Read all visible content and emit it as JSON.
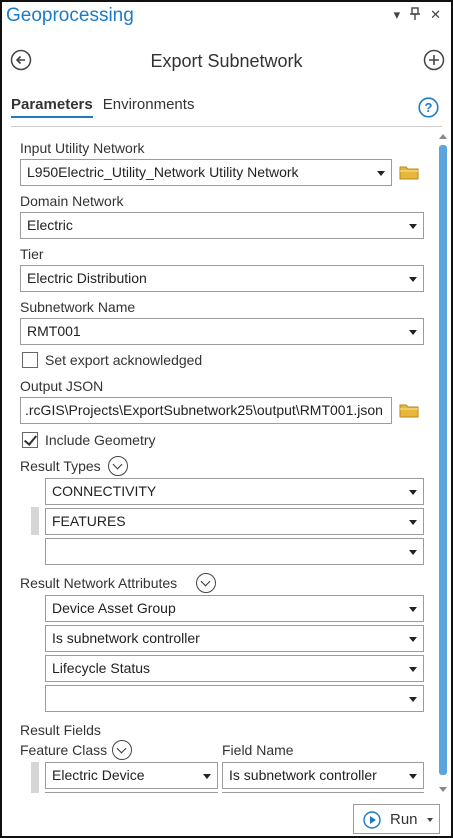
{
  "pane": {
    "title": "Geoprocessing",
    "ctrl_dropdown": "▾",
    "ctrl_pin": "ᚁ",
    "ctrl_close": "✕"
  },
  "tool": {
    "title": "Export Subnetwork"
  },
  "tabs": [
    {
      "label": "Parameters",
      "active": true
    },
    {
      "label": "Environments",
      "active": false
    }
  ],
  "params": {
    "input_network": {
      "label": "Input Utility Network",
      "value": "L950Electric_Utility_Network Utility Network"
    },
    "domain_network": {
      "label": "Domain Network",
      "value": "Electric"
    },
    "tier": {
      "label": "Tier",
      "value": "Electric Distribution"
    },
    "subnetwork_name": {
      "label": "Subnetwork Name",
      "value": "RMT001"
    },
    "set_export_ack": {
      "label": "Set export acknowledged",
      "checked": false
    },
    "output_json": {
      "label": "Output JSON",
      "value": ".rcGIS\\Projects\\ExportSubnetwork25\\output\\RMT001.json"
    },
    "include_geometry": {
      "label": "Include Geometry",
      "checked": true
    },
    "result_types": {
      "label": "Result Types",
      "values": [
        "CONNECTIVITY",
        "FEATURES",
        ""
      ]
    },
    "result_network_attributes": {
      "label": "Result Network Attributes",
      "values": [
        "Device Asset Group",
        "Is subnetwork controller",
        "Lifecycle Status",
        ""
      ]
    },
    "result_fields": {
      "label": "Result Fields",
      "col_feature_class": "Feature Class",
      "col_field_name": "Field Name",
      "rows": [
        {
          "feature_class": "Electric Device",
          "field_name": "Is subnetwork controller"
        }
      ]
    }
  },
  "run": {
    "label": "Run"
  },
  "colors": {
    "accent": "#1e7bc6",
    "scroll_thumb": "#5aa5e0",
    "folder": "#e8b73a"
  }
}
